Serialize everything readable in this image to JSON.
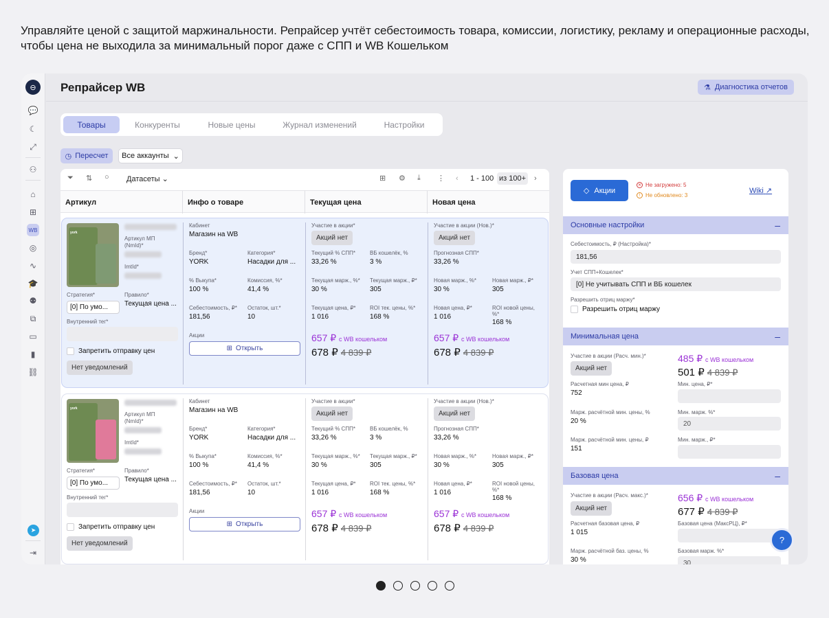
{
  "caption": "Управляйте ценой с защитой маржинальности. Репрайсер учтёт себестоимость товара, комиссии, логистику, рекламу и операционные расходы, чтобы цена не выходила за минимальный порог даже с СПП и WB Кошельком",
  "app": {
    "title": "Репрайсер WB",
    "diag_label": "Диагностика отчетов"
  },
  "tabs": [
    "Товары",
    "Конкуренты",
    "Новые цены",
    "Журнал изменений",
    "Настройки"
  ],
  "toolbar": {
    "recalc": "Пересчет",
    "accounts": "Все аккаунты",
    "datasets": "Датасеты",
    "range": "1 - 100",
    "total": "из 100+"
  },
  "columns": [
    "Артикул",
    "Инфо о товаре",
    "Текущая цена",
    "Новая цена"
  ],
  "labels": {
    "nmid": "Артикул МП (NmId)*",
    "imtid": "ImtId*",
    "strategy": "Стратегия*",
    "rule": "Правило*",
    "inner_tag": "Внутренний тег*",
    "forbid": "Запретить отправку цен",
    "no_notif": "Нет уведомлений",
    "cabinet": "Кабинет",
    "brand": "Бренд*",
    "category": "Категория*",
    "buyout": "% Выкупа*",
    "commission": "Комиссия, %*",
    "cost": "Себестоимость, ₽*",
    "stock": "Остаток, шт.*",
    "promos": "Акции",
    "open": "Открыть",
    "promo_part": "Участие в акции*",
    "promo_part_new": "Участие в акции (Нов.)*",
    "spp": "Текущий % СПП*",
    "wb_wallet": "ВБ кошелёк, %",
    "forecast_spp": "Прогнозная СПП*",
    "cur_margin_pct": "Текущая марж., %*",
    "cur_margin_rub": "Текущая марж., ₽*",
    "new_margin_pct": "Новая марж., %*",
    "new_margin_rub": "Новая марж., ₽*",
    "cur_price": "Текущая цена, ₽*",
    "roi_cur": "ROI тек. цены, %*",
    "new_price": "Новая цена, ₽*",
    "roi_new": "ROI новой цены, %*",
    "with_wallet": "с WB кошельком"
  },
  "products": [
    {
      "strategy": "[0] По умо...",
      "rule": "Текущая цена ...",
      "cabinet": "Магазин на WB",
      "brand": "YORK",
      "category": "Насадки для ...",
      "buyout": "100 %",
      "commission": "41,4 %",
      "cost": "181,56",
      "stock": "10",
      "promo": "Акций нет",
      "spp": "33,26 %",
      "wallet": "3 %",
      "cur_margin_pct": "30 %",
      "cur_margin_rub": "305",
      "cur_price": "1 016",
      "roi_cur": "168 %",
      "wallet_price": "657 ₽",
      "price": "678 ₽",
      "old_price": "4 839 ₽",
      "new_promo": "Акций нет",
      "forecast_spp": "33,26 %",
      "new_margin_pct": "30 %",
      "new_margin_rub": "305",
      "new_price": "1 016",
      "roi_new": "168 %",
      "new_wallet_price": "657 ₽",
      "new_final": "678 ₽",
      "new_old": "4 839 ₽"
    },
    {
      "strategy": "[0] По умо...",
      "rule": "Текущая цена ...",
      "cabinet": "Магазин на WB",
      "brand": "YORK",
      "category": "Насадки для ...",
      "buyout": "100 %",
      "commission": "41,4 %",
      "cost": "181,56",
      "stock": "10",
      "promo": "Акций нет",
      "spp": "33,26 %",
      "wallet": "3 %",
      "cur_margin_pct": "30 %",
      "cur_margin_rub": "305",
      "cur_price": "1 016",
      "roi_cur": "168 %",
      "wallet_price": "657 ₽",
      "price": "678 ₽",
      "old_price": "4 839 ₽",
      "new_promo": "Акций нет",
      "forecast_spp": "33,26 %",
      "new_margin_pct": "30 %",
      "new_margin_rub": "305",
      "new_price": "1 016",
      "roi_new": "168 %",
      "new_wallet_price": "657 ₽",
      "new_final": "678 ₽",
      "new_old": "4 839 ₽"
    }
  ],
  "panel": {
    "promo_btn": "Акции",
    "not_loaded": "Не загружено: 5",
    "not_updated": "Не обновлено: 3",
    "wiki": "Wiki",
    "sec_basic": "Основные настройки",
    "cost_label": "Себестоимость, ₽ (Настройка)*",
    "cost_value": "181,56",
    "spp_label": "Учет СПП+Кошелек*",
    "spp_value": "[0] Не учитывать СПП и ВБ кошелек",
    "neg_label": "Разрешить отриц маржу*",
    "neg_check": "Разрешить отриц маржу",
    "sec_min": "Минимальная цена",
    "min_promo_label": "Участие в акции (Расч. мин.)*",
    "min_promo": "Акций нет",
    "min_wallet": "485 ₽",
    "min_price": "501 ₽",
    "min_old": "4 839 ₽",
    "min_calc_label": "Расчетная мин цена, ₽",
    "min_calc": "752",
    "min_price_label": "Мин. цена, ₽*",
    "min_marg_pct_label": "Марж. расчётной мин. цены, %",
    "min_marg_pct": "20 %",
    "min_marg_label": "Мин. марж. %*",
    "min_marg": "20",
    "min_marg_rub_label": "Марж. расчётной мин. цены, ₽",
    "min_marg_rub": "151",
    "min_marg_rub_field": "Мин. марж., ₽*",
    "sec_base": "Базовая цена",
    "base_promo_label": "Участие в акции (Расч. макс.)*",
    "base_promo": "Акций нет",
    "base_wallet": "656 ₽",
    "base_price": "677 ₽",
    "base_old": "4 839 ₽",
    "base_calc_label": "Расчетная базовая цена, ₽",
    "base_calc": "1 015",
    "base_max_label": "Базовая цена (МаксРЦ), ₽*",
    "base_marg_pct_label": "Марж. расчётной баз. цены, %",
    "base_marg_pct": "30 %",
    "base_marg_label": "Базовая марж. %*",
    "base_marg": "30"
  },
  "pagination": {
    "pages": 5,
    "current": 1
  }
}
